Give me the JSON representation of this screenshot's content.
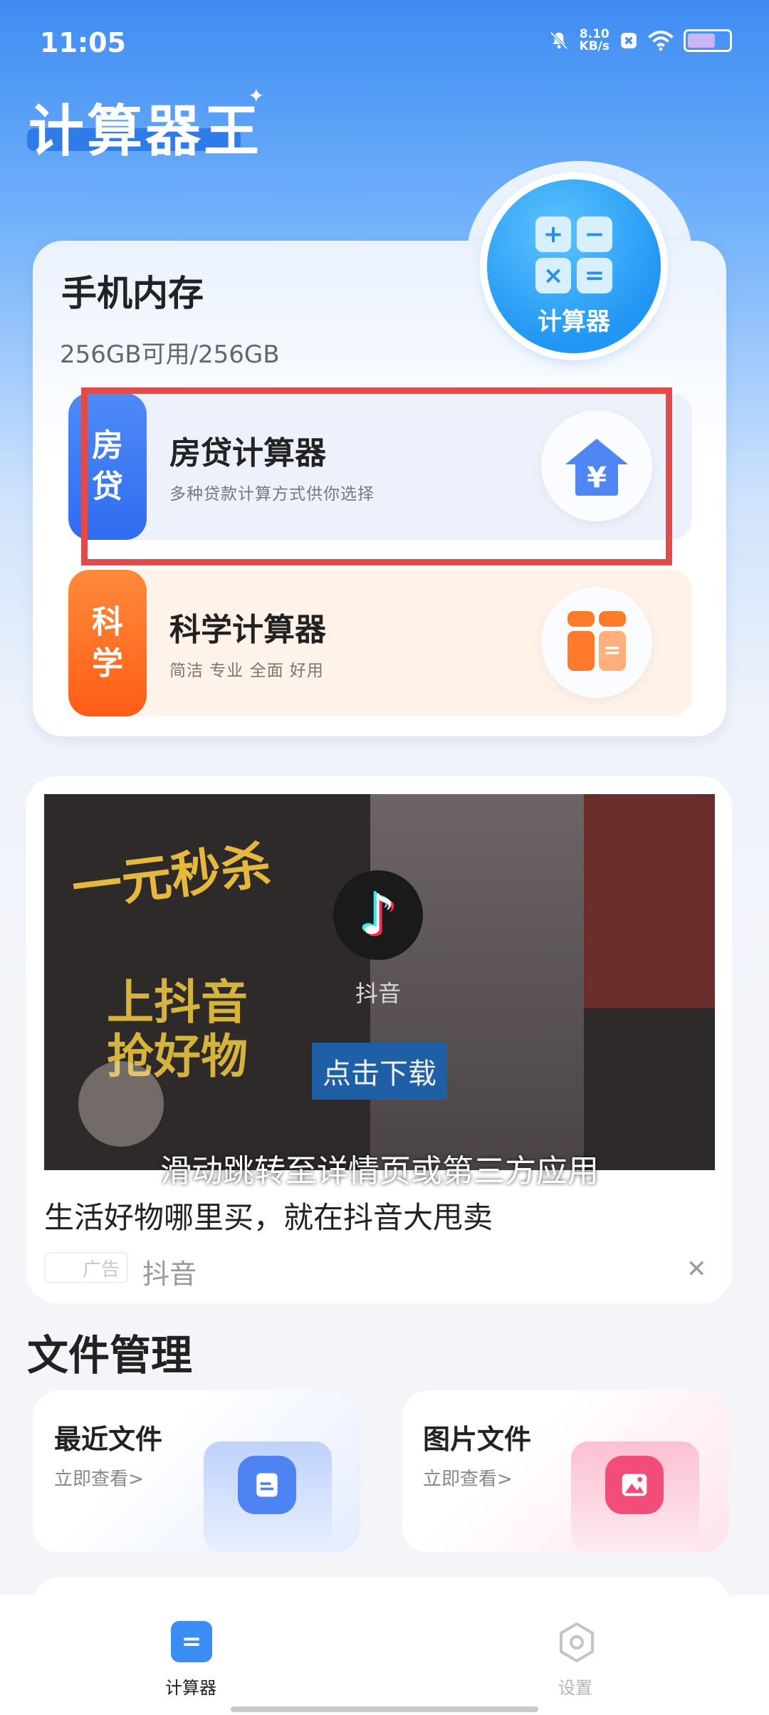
{
  "status_bar": {
    "time": "11:05",
    "net_speed_value": "8.10",
    "net_speed_unit": "KB/s",
    "icons": [
      "mute-bell-icon",
      "close-box-icon",
      "wifi-icon",
      "battery-icon"
    ]
  },
  "app": {
    "title": "计算器王"
  },
  "storage": {
    "title": "手机内存",
    "subtitle": "256GB可用/256GB",
    "calc_button_label": "计算器",
    "calc_symbols": [
      "+",
      "−",
      "×",
      "="
    ]
  },
  "features": [
    {
      "tag_chars": [
        "房",
        "贷"
      ],
      "title": "房贷计算器",
      "subtitle": "多种贷款计算方式供你选择",
      "icon": "house-yen-icon"
    },
    {
      "tag_chars": [
        "科",
        "学"
      ],
      "title": "科学计算器",
      "subtitle": "简洁 专业 全面 好用",
      "icon": "grid-calculator-icon"
    }
  ],
  "ad": {
    "promo_line1": "一元秒杀",
    "promo_line2": "上抖音",
    "promo_line3": "抢好物",
    "brand": "抖音",
    "download_label": "点击下载",
    "overlay_caption": "滑动跳转至详情页或第三方应用",
    "headline": "生活好物哪里买，就在抖音大甩卖",
    "badge": "广告",
    "source": "抖音",
    "close_symbol": "✕"
  },
  "files": {
    "section_title": "文件管理",
    "cards": [
      {
        "title": "最近文件",
        "link": "立即查看>",
        "icon": "document-icon",
        "color": "#4f83f3"
      },
      {
        "title": "图片文件",
        "link": "立即查看>",
        "icon": "image-icon",
        "color": "#f24d78"
      }
    ]
  },
  "nav": {
    "items": [
      {
        "label": "计算器",
        "active": true,
        "icon": "calculator-icon"
      },
      {
        "label": "设置",
        "active": false,
        "icon": "settings-hexagon-icon"
      }
    ]
  },
  "colors": {
    "accent": "#3c8cf5",
    "highlight": "#e34a4a",
    "science": "#ff6a1f"
  }
}
